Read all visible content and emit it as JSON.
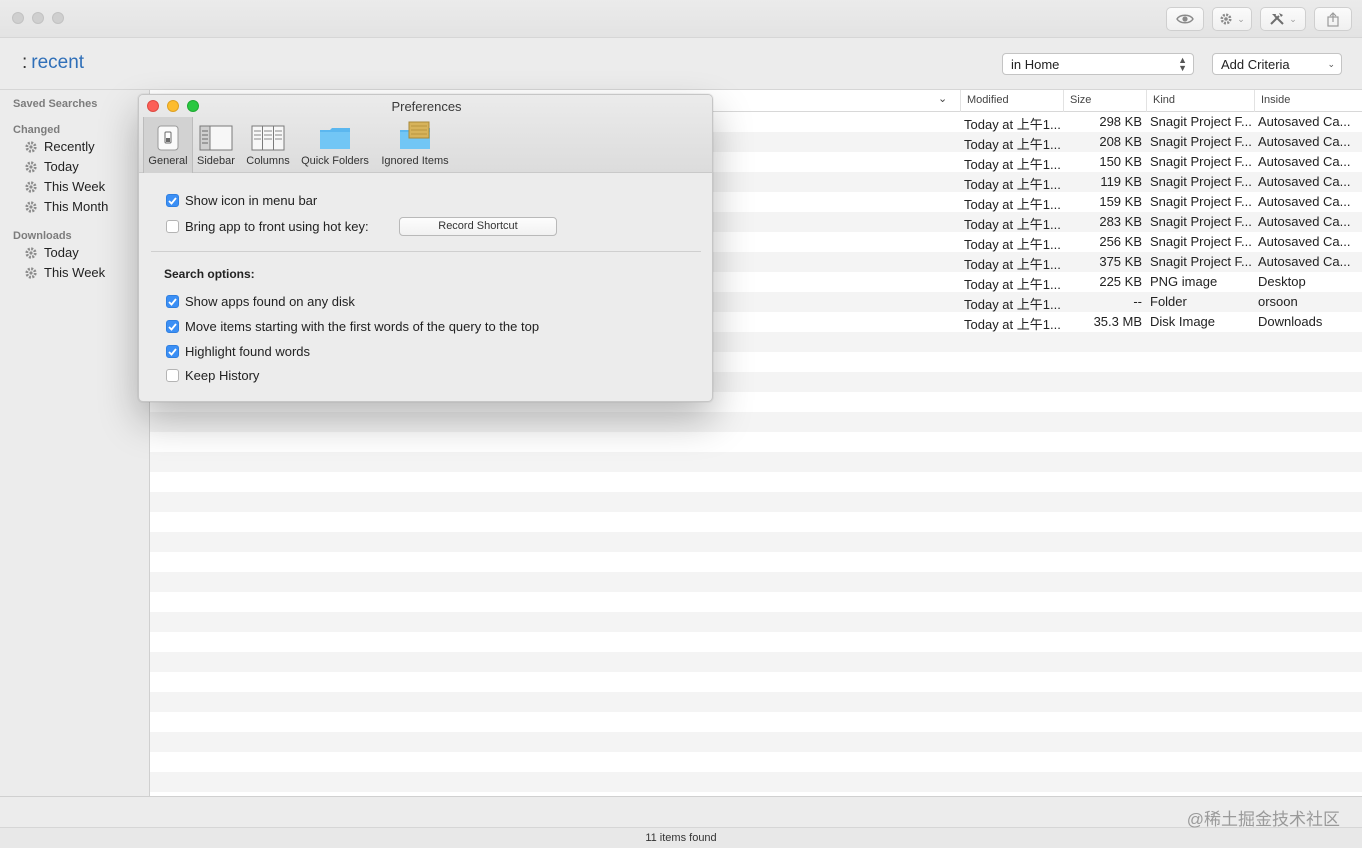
{
  "window": {
    "toolbar": {
      "eye_icon": "eye-icon",
      "gear_icon": "gear-icon",
      "tools_icon": "tools-icon",
      "share_icon": "share-icon"
    }
  },
  "search": {
    "colon": ":",
    "query": "recent",
    "location_select": "in Home",
    "criteria_select": "Add Criteria"
  },
  "sidebar": {
    "saved_searches": "Saved Searches",
    "changed_header": "Changed",
    "changed_items": [
      "Recently",
      "Today",
      "This Week",
      "This Month"
    ],
    "downloads_header": "Downloads",
    "downloads_items": [
      "Today",
      "This Week"
    ]
  },
  "table": {
    "columns": {
      "modified": "Modified",
      "size": "Size",
      "kind": "Kind",
      "inside": "Inside"
    },
    "rows": [
      {
        "modified": "Today at 上午1...",
        "size": "298 KB",
        "kind": "Snagit Project F...",
        "inside": "Autosaved Ca..."
      },
      {
        "modified": "Today at 上午1...",
        "size": "208 KB",
        "kind": "Snagit Project F...",
        "inside": "Autosaved Ca..."
      },
      {
        "modified": "Today at 上午1...",
        "size": "150 KB",
        "kind": "Snagit Project F...",
        "inside": "Autosaved Ca..."
      },
      {
        "modified": "Today at 上午1...",
        "size": "119 KB",
        "kind": "Snagit Project F...",
        "inside": "Autosaved Ca..."
      },
      {
        "modified": "Today at 上午1...",
        "size": "159 KB",
        "kind": "Snagit Project F...",
        "inside": "Autosaved Ca..."
      },
      {
        "modified": "Today at 上午1...",
        "size": "283 KB",
        "kind": "Snagit Project F...",
        "inside": "Autosaved Ca..."
      },
      {
        "modified": "Today at 上午1...",
        "size": "256 KB",
        "kind": "Snagit Project F...",
        "inside": "Autosaved Ca..."
      },
      {
        "modified": "Today at 上午1...",
        "size": "375 KB",
        "kind": "Snagit Project F...",
        "inside": "Autosaved Ca..."
      },
      {
        "modified": "Today at 上午1...",
        "size": "225 KB",
        "kind": "PNG image",
        "inside": "Desktop"
      },
      {
        "modified": "Today at 上午1...",
        "size": "--",
        "kind": "Folder",
        "inside": "orsoon"
      },
      {
        "modified": "Today at 上午1...",
        "size": "35.3 MB",
        "kind": "Disk Image",
        "inside": "Downloads"
      }
    ]
  },
  "status": {
    "items_found": "11 items found",
    "watermark": "@稀土掘金技术社区"
  },
  "preferences": {
    "title": "Preferences",
    "tabs": [
      "General",
      "Sidebar",
      "Columns",
      "Quick Folders",
      "Ignored Items"
    ],
    "show_icon_menu_bar": "Show icon in menu bar",
    "bring_to_front": "Bring app to front using hot key:",
    "record_shortcut": "Record Shortcut",
    "search_options": "Search options:",
    "show_apps_any_disk": "Show apps found on any disk",
    "move_items_top": "Move items starting with the first words of the query to the top",
    "highlight_found": "Highlight found words",
    "keep_history": "Keep History"
  },
  "colors": {
    "accent": "#3b8ff5",
    "query_text": "#2f6fb8",
    "close": "#fc5f57",
    "minimize": "#fdbc2e",
    "zoom": "#28c840"
  }
}
